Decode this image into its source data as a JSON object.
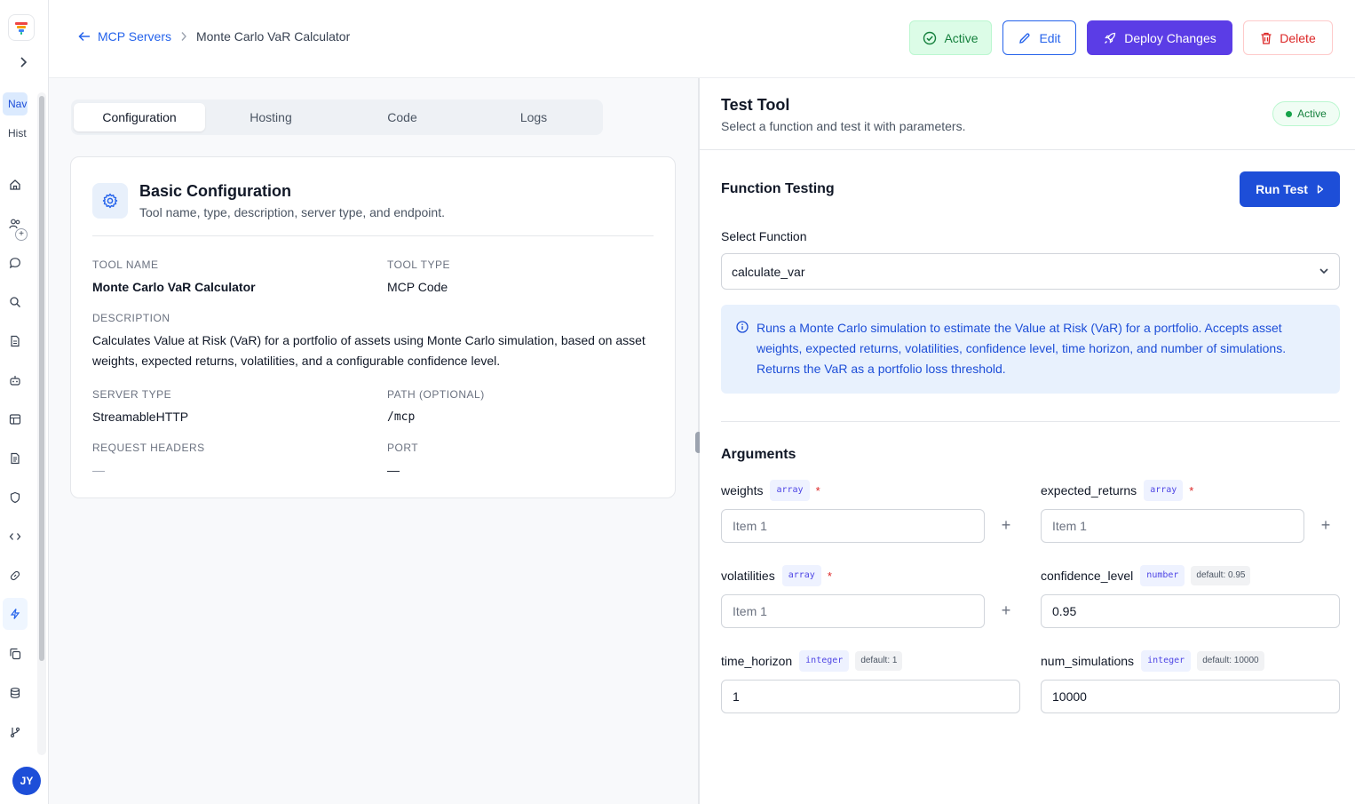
{
  "sidebar": {
    "tab_nav": "Nav",
    "tab_history": "Hist",
    "avatar_initials": "JY"
  },
  "header": {
    "back_label": "MCP Servers",
    "current_page": "Monte Carlo VaR Calculator",
    "active_label": "Active",
    "edit_label": "Edit",
    "deploy_label": "Deploy Changes",
    "delete_label": "Delete"
  },
  "tabs": [
    "Configuration",
    "Hosting",
    "Code",
    "Logs"
  ],
  "config": {
    "title": "Basic Configuration",
    "subtitle": "Tool name, type, description, server type, and endpoint.",
    "tool_name_label": "TOOL NAME",
    "tool_name": "Monte Carlo VaR Calculator",
    "tool_type_label": "TOOL TYPE",
    "tool_type": "MCP Code",
    "description_label": "DESCRIPTION",
    "description": "Calculates Value at Risk (VaR) for a portfolio of assets using Monte Carlo simulation, based on asset weights, expected returns, volatilities, and a configurable confidence level.",
    "server_type_label": "SERVER TYPE",
    "server_type": "StreamableHTTP",
    "path_label": "PATH (OPTIONAL)",
    "path": "/mcp",
    "headers_label": "REQUEST HEADERS",
    "headers": "—",
    "port_label": "PORT",
    "port": "—"
  },
  "test": {
    "title": "Test Tool",
    "subtitle": "Select a function and test it with parameters.",
    "status": "Active",
    "function_testing": "Function Testing",
    "run_label": "Run Test",
    "select_label": "Select Function",
    "selected_function": "calculate_var",
    "info": "Runs a Monte Carlo simulation to estimate the Value at Risk (VaR) for a portfolio. Accepts asset weights, expected returns, volatilities, confidence level, time horizon, and number of simulations. Returns the VaR as a portfolio loss threshold.",
    "arguments_title": "Arguments",
    "args": {
      "weights": {
        "name": "weights",
        "type": "array",
        "required": "*",
        "placeholder": "Item 1"
      },
      "expected_returns": {
        "name": "expected_returns",
        "type": "array",
        "required": "*",
        "placeholder": "Item 1"
      },
      "volatilities": {
        "name": "volatilities",
        "type": "array",
        "required": "*",
        "placeholder": "Item 1"
      },
      "confidence_level": {
        "name": "confidence_level",
        "type": "number",
        "default": "default: 0.95",
        "value": "0.95"
      },
      "time_horizon": {
        "name": "time_horizon",
        "type": "integer",
        "default": "default: 1",
        "value": "1"
      },
      "num_simulations": {
        "name": "num_simulations",
        "type": "integer",
        "default": "default: 10000",
        "value": "10000"
      }
    }
  }
}
